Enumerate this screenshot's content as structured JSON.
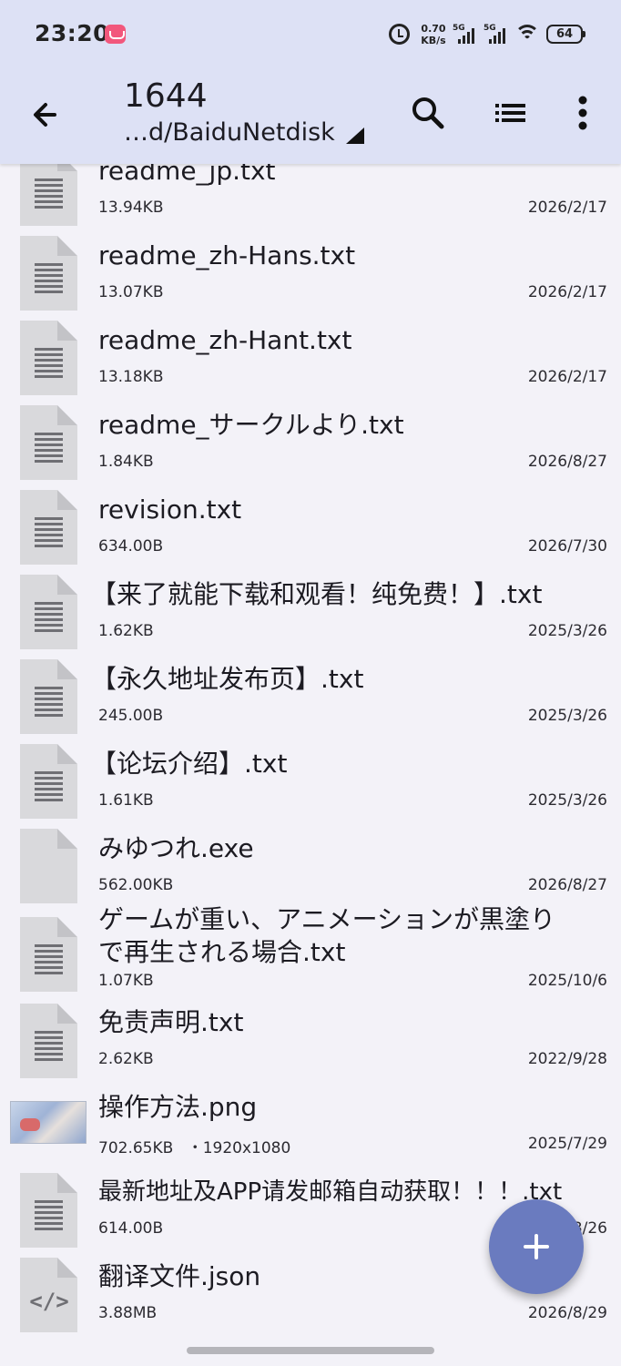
{
  "status_bar": {
    "time": "23:20",
    "net_speed_value": "0.70",
    "net_speed_unit": "KB/s",
    "signal1": "5G",
    "signal2": "5G",
    "battery": "64"
  },
  "app_bar": {
    "title": "1644",
    "path": "…d/BaiduNetdisk",
    "icons": [
      "back-arrow-icon",
      "search-icon",
      "list-view-icon",
      "more-vert-icon"
    ]
  },
  "files": [
    {
      "name": "readme_jp.txt",
      "size": "13.94KB",
      "date": "2026/2/17",
      "icon": "text-file-icon"
    },
    {
      "name": "readme_zh-Hans.txt",
      "size": "13.07KB",
      "date": "2026/2/17",
      "icon": "text-file-icon"
    },
    {
      "name": "readme_zh-Hant.txt",
      "size": "13.18KB",
      "date": "2026/2/17",
      "icon": "text-file-icon"
    },
    {
      "name": "readme_サークルより.txt",
      "size": "1.84KB",
      "date": "2026/8/27",
      "icon": "text-file-icon"
    },
    {
      "name": "revision.txt",
      "size": "634.00B",
      "date": "2026/7/30",
      "icon": "text-file-icon"
    },
    {
      "name": "【来了就能下载和观看！纯免费！】.txt",
      "size": "1.62KB",
      "date": "2025/3/26",
      "icon": "text-file-icon"
    },
    {
      "name": "【永久地址发布页】.txt",
      "size": "245.00B",
      "date": "2025/3/26",
      "icon": "text-file-icon"
    },
    {
      "name": "【论坛介绍】.txt",
      "size": "1.61KB",
      "date": "2025/3/26",
      "icon": "text-file-icon"
    },
    {
      "name": "みゆつれ.exe",
      "size": "562.00KB",
      "date": "2026/8/27",
      "icon": "generic-file-icon"
    },
    {
      "name_line1": "ゲームが重い、アニメーションが黒塗り",
      "name_line2": "で再生される場合.txt",
      "size": "1.07KB",
      "date": "2025/10/6",
      "icon": "text-file-icon"
    },
    {
      "name": "免责声明.txt",
      "size": "2.62KB",
      "date": "2022/9/28",
      "icon": "text-file-icon"
    },
    {
      "name": "操作方法.png",
      "size": "702.65KB",
      "resolution": "・1920x1080",
      "date": "2025/7/29",
      "icon": "image-thumbnail"
    },
    {
      "name": "最新地址及APP请发邮箱自动获取！！！.txt",
      "size": "614.00B",
      "date": "2025/3/26",
      "icon": "text-file-icon"
    },
    {
      "name": "翻译文件.json",
      "size": "3.88MB",
      "date": "2026/8/29",
      "icon": "code-file-icon"
    }
  ],
  "fab": {
    "icon": "add-icon"
  },
  "colors": {
    "app_bar_bg": "#dde1f5",
    "list_bg": "#f3f2f8",
    "fab_bg": "#6a7bbf",
    "file_icon_bg": "#d9d9dc"
  }
}
